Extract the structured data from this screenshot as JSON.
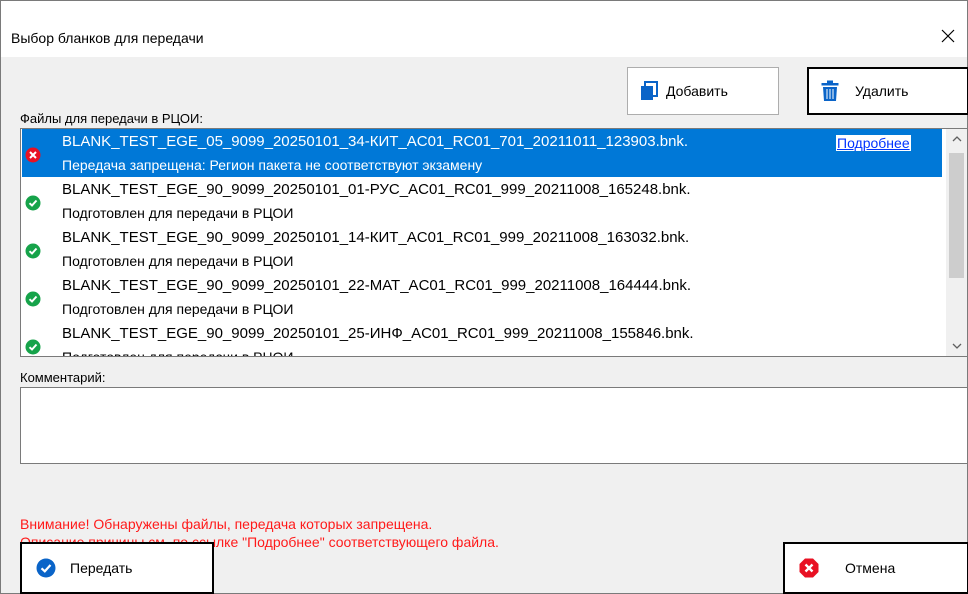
{
  "window": {
    "title": "Выбор бланков для передачи"
  },
  "toolbar": {
    "add_label": "Добавить",
    "delete_label": "Удалить"
  },
  "files_label": "Файлы для передачи в РЦОИ:",
  "more_link": "Подробнее",
  "files": [
    {
      "name": "BLANK_TEST_EGE_05_9099_20250101_34-КИТ_AC01_RC01_701_20211011_123903.bnk.",
      "status": "Передача запрещена: Регион пакета не соответствуют экзамену",
      "state": "error",
      "selected": true
    },
    {
      "name": "BLANK_TEST_EGE_90_9099_20250101_01-РУС_AC01_RC01_999_20211008_165248.bnk.",
      "status": "Подготовлен для передачи в РЦОИ",
      "state": "ok",
      "selected": false
    },
    {
      "name": "BLANK_TEST_EGE_90_9099_20250101_14-КИТ_AC01_RC01_999_20211008_163032.bnk.",
      "status": "Подготовлен для передачи в РЦОИ",
      "state": "ok",
      "selected": false
    },
    {
      "name": "BLANK_TEST_EGE_90_9099_20250101_22-МАТ_AC01_RC01_999_20211008_164444.bnk.",
      "status": "Подготовлен для передачи в РЦОИ",
      "state": "ok",
      "selected": false
    },
    {
      "name": "BLANK_TEST_EGE_90_9099_20250101_25-ИНФ_AC01_RC01_999_20211008_155846.bnk.",
      "status": "Подготовлен для передачи в РЦОИ",
      "state": "ok",
      "selected": false
    }
  ],
  "comment_label": "Комментарий:",
  "comment_value": "",
  "warning": {
    "line1": "Внимание! Обнаружены файлы, передача которых запрещена.",
    "line2": "Описание причины см. по ссылке \"Подробнее\" соответствующего файла."
  },
  "footer": {
    "send_label": "Передать",
    "cancel_label": "Отмена"
  },
  "colors": {
    "selection": "#0078d7",
    "error": "#e81123",
    "ok": "#16a34a",
    "link": "#0033ff",
    "warning_text": "#ff1a1a",
    "accent_icon": "#0a64c8"
  }
}
